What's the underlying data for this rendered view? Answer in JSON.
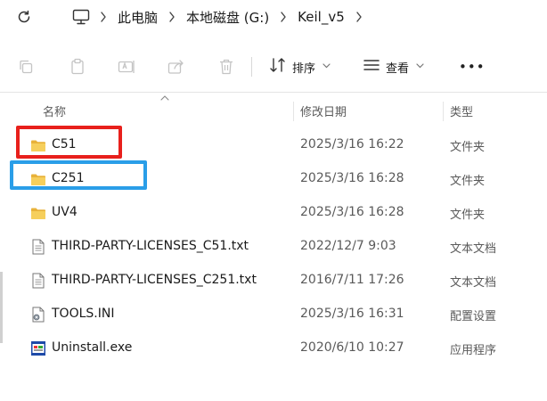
{
  "breadcrumbs": [
    "此电脑",
    "本地磁盘 (G:)",
    "Keil_v5"
  ],
  "toolbar": {
    "sort_label": "排序",
    "view_label": "查看",
    "more_label": "•••"
  },
  "columns": {
    "name": "名称",
    "modified": "修改日期",
    "type": "类型"
  },
  "files": [
    {
      "name": "C51",
      "modified": "2025/3/16 16:22",
      "type": "文件夹",
      "icon": "folder-icon"
    },
    {
      "name": "C251",
      "modified": "2025/3/16 16:28",
      "type": "文件夹",
      "icon": "folder-icon"
    },
    {
      "name": "UV4",
      "modified": "2025/3/16 16:28",
      "type": "文件夹",
      "icon": "folder-icon"
    },
    {
      "name": "THIRD-PARTY-LICENSES_C51.txt",
      "modified": "2022/12/7 9:03",
      "type": "文本文档",
      "icon": "text-file-icon"
    },
    {
      "name": "THIRD-PARTY-LICENSES_C251.txt",
      "modified": "2016/7/11 17:26",
      "type": "文本文档",
      "icon": "text-file-icon"
    },
    {
      "name": "TOOLS.INI",
      "modified": "2025/3/16 16:31",
      "type": "配置设置",
      "icon": "settings-file-icon"
    },
    {
      "name": "Uninstall.exe",
      "modified": "2020/6/10 10:27",
      "type": "应用程序",
      "icon": "exe-file-icon"
    }
  ],
  "colors": {
    "folder": "#f2c14e",
    "highlight_red": "#e8201c",
    "highlight_blue": "#2a9ee8",
    "accent": "#0067c0"
  }
}
